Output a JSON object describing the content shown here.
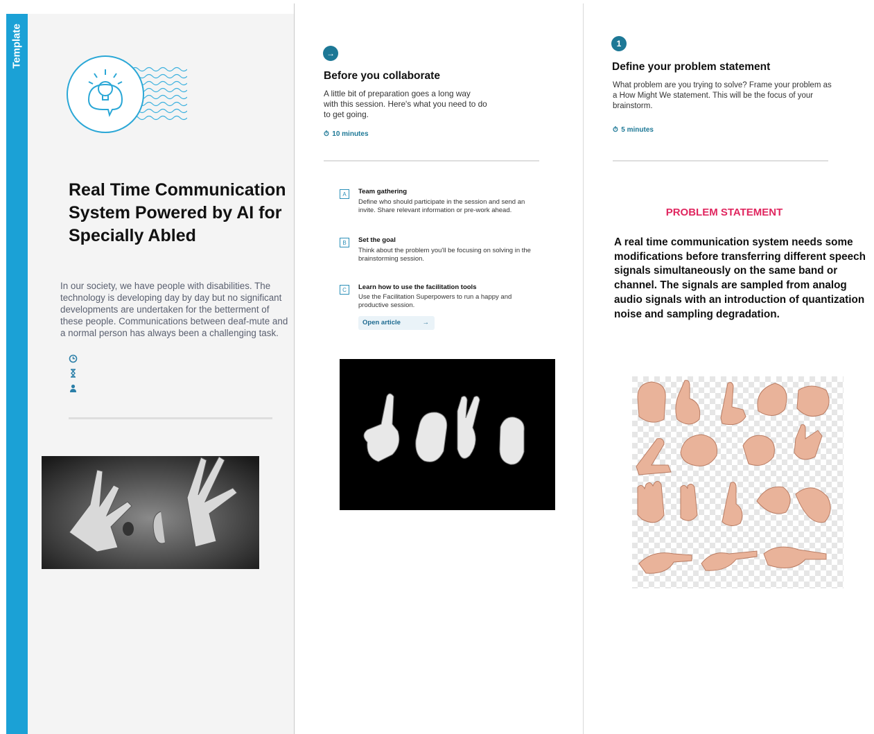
{
  "side_tab": {
    "label": "Template"
  },
  "left": {
    "title": "Real Time Communication System Powered  by AI for Specially  Abled",
    "description": "In our society, we have people with disabilities. The technology is developing day by day but no significant developments are undertaken for the betterment of these people. Communications between deaf-mute and a normal person has always been a challenging task.",
    "meta_icons": [
      "clock-icon",
      "hourglass-icon",
      "person-icon"
    ]
  },
  "middle": {
    "heading": "Before you collaborate",
    "intro": "A little bit of preparation goes a long way with this session. Here's what you need to do to get going.",
    "time": "10 minutes",
    "steps": [
      {
        "letter": "A",
        "title": "Team gathering",
        "desc": "Define who should participate in the session and send an invite. Share relevant information or pre-work ahead."
      },
      {
        "letter": "B",
        "title": "Set the goal",
        "desc": "Think about the problem you'll be focusing on solving in the brainstorming session."
      },
      {
        "letter": "C",
        "title": "Learn how to use the facilitation tools",
        "desc": "Use the Facilitation Superpowers to run a happy and productive session."
      }
    ],
    "open_article": "Open article"
  },
  "right": {
    "badge": "1",
    "heading": "Define your problem statement",
    "intro": "What problem are you trying to solve? Frame your problem as a How Might We statement. This will be the focus of your brainstorm.",
    "time": "5 minutes",
    "ps_label": "PROBLEM STATEMENT",
    "ps_text": "A real time communication system needs some modifications before transferring different speech signals simultaneously on the same band or channel. The signals are sampled from analog audio signals with an introduction of quantization noise and sampling degradation."
  },
  "colors": {
    "accent": "#1ba1d6",
    "teal": "#1d7896",
    "pink": "#e0265f"
  }
}
